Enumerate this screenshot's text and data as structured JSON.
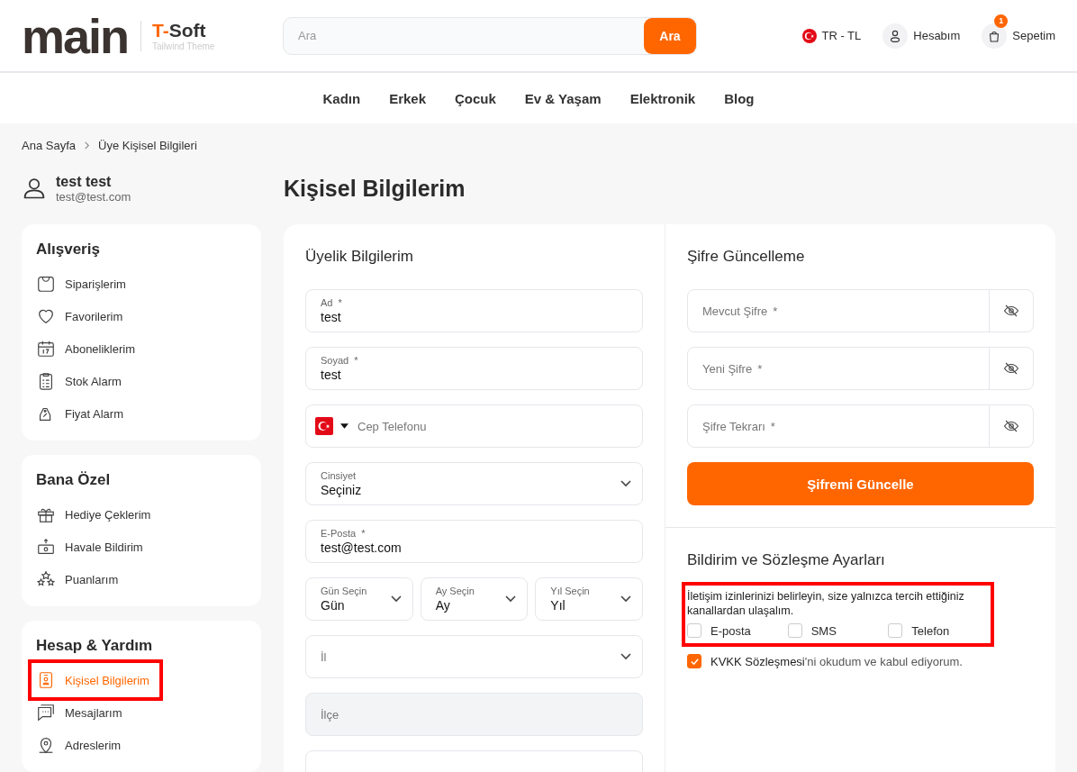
{
  "header": {
    "logo": {
      "wordmark": "main",
      "brand_prefix": "T-",
      "brand": "Soft",
      "tagline": "Tailwind Theme"
    },
    "search": {
      "placeholder": "Ara",
      "button": "Ara"
    },
    "locale": "TR - TL",
    "account": "Hesabım",
    "cart": {
      "label": "Sepetim",
      "count": "1"
    }
  },
  "nav": [
    "Kadın",
    "Erkek",
    "Çocuk",
    "Ev & Yaşam",
    "Elektronik",
    "Blog"
  ],
  "breadcrumb": [
    "Ana Sayfa",
    "Üye Kişisel Bilgileri"
  ],
  "user": {
    "name": "test test",
    "email": "test@test.com"
  },
  "sidebar": {
    "sections": [
      {
        "title": "Alışveriş",
        "items": [
          {
            "label": "Siparişlerim",
            "kind": "bag",
            "selected": false,
            "highlighted": false
          },
          {
            "label": "Favorilerim",
            "kind": "heart",
            "selected": false,
            "highlighted": false
          },
          {
            "label": "Aboneliklerim",
            "kind": "calendar",
            "selected": false,
            "highlighted": false
          },
          {
            "label": "Stok Alarm",
            "kind": "clipboard",
            "selected": false,
            "highlighted": false
          },
          {
            "label": "Fiyat Alarm",
            "kind": "tag",
            "selected": false,
            "highlighted": false
          }
        ]
      },
      {
        "title": "Bana Özel",
        "items": [
          {
            "label": "Hediye Çeklerim",
            "kind": "gift",
            "selected": false,
            "highlighted": false
          },
          {
            "label": "Havale Bildirim",
            "kind": "money",
            "selected": false,
            "highlighted": false
          },
          {
            "label": "Puanlarım",
            "kind": "stars",
            "selected": false,
            "highlighted": false
          }
        ]
      },
      {
        "title": "Hesap & Yardım",
        "items": [
          {
            "label": "Kişisel Bilgilerim",
            "kind": "badge",
            "selected": true,
            "highlighted": true
          },
          {
            "label": "Mesajlarım",
            "kind": "chat",
            "selected": false,
            "highlighted": false
          },
          {
            "label": "Adreslerim",
            "kind": "pin",
            "selected": false,
            "highlighted": false
          }
        ]
      }
    ]
  },
  "page_title": "Kişisel Bilgilerim",
  "membership": {
    "title": "Üyelik Bilgilerim",
    "fields": [
      {
        "kind": "text",
        "label": "Ad",
        "mark": "*",
        "value": "test"
      },
      {
        "kind": "text",
        "label": "Soyad",
        "mark": "*",
        "value": "test"
      },
      {
        "kind": "phone",
        "placeholder": "Cep Telefonu"
      },
      {
        "kind": "select",
        "label": "Cinsiyet",
        "value": "Seçiniz"
      },
      {
        "kind": "text",
        "label": "E-Posta",
        "mark": "*",
        "value": "test@test.com"
      },
      {
        "kind": "date",
        "parts": [
          {
            "label": "Gün Seçin",
            "value": "Gün"
          },
          {
            "label": "Ay Seçin",
            "value": "Ay"
          },
          {
            "label": "Yıl Seçin",
            "value": "Yıl"
          }
        ]
      },
      {
        "kind": "select",
        "placeholder": "İl"
      },
      {
        "kind": "text",
        "placeholder": "İlçe",
        "disabled": true
      },
      {
        "kind": "text"
      }
    ]
  },
  "password": {
    "title": "Şifre Güncelleme",
    "fields": [
      {
        "placeholder": "Mevcut Şifre",
        "mark": "*"
      },
      {
        "placeholder": "Yeni Şifre",
        "mark": "*"
      },
      {
        "placeholder": "Şifre Tekrarı",
        "mark": "*"
      }
    ],
    "button": "Şifremi Güncelle"
  },
  "consent": {
    "title": "Bildirim ve Sözleşme Ayarları",
    "highlighted": true,
    "intro": "İletişim izinlerinizi belirleyin, size yalnızca tercih ettiğiniz kanallardan ulaşalım.",
    "channels": [
      {
        "label": "E-posta",
        "checked": false
      },
      {
        "label": "SMS",
        "checked": false
      },
      {
        "label": "Telefon",
        "checked": false
      }
    ],
    "agreement": {
      "text": "**KVKK Sözleşmesi**'ni okudum ve kabul ediyorum.",
      "checked": true
    }
  }
}
